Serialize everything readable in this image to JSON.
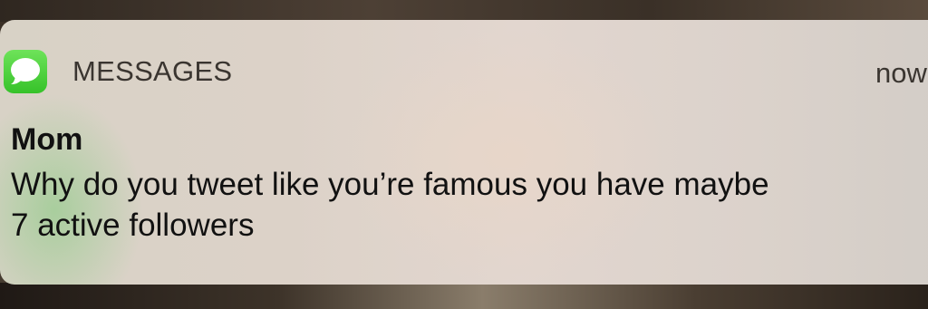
{
  "notification": {
    "app_name": "MESSAGES",
    "app_icon": "messages-bubble-icon",
    "app_icon_color": "#4cd137",
    "timestamp": "now",
    "sender": "Mom",
    "message_lines": [
      "Why do you tweet like you’re famous you have maybe",
      "7 active followers"
    ]
  }
}
